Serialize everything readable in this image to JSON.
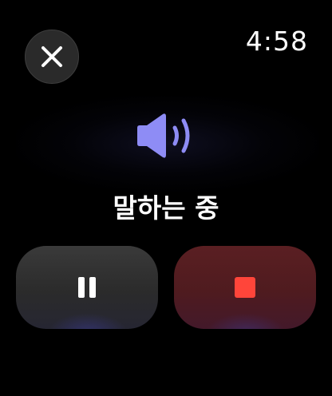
{
  "clock": {
    "time": "4:58"
  },
  "status": {
    "label": "말하는 중"
  },
  "icons": {
    "close": "close-icon",
    "speaker": "speaker-icon",
    "pause": "pause-icon",
    "stop": "stop-icon"
  },
  "colors": {
    "background": "#000000",
    "speaker_accent": "#8e8cf5",
    "stop_red": "#ff453a",
    "stop_button_bg": "#551d21",
    "pause_button_bg": "#333333"
  }
}
